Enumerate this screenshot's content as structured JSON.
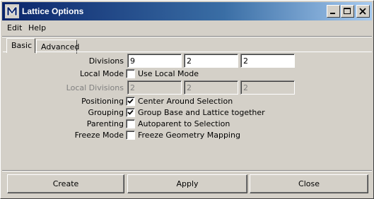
{
  "window": {
    "title": "Lattice Options",
    "icon": "maya-logo-icon",
    "controls": [
      "minimize-icon",
      "maximize-icon",
      "close-icon"
    ]
  },
  "menubar": {
    "items": [
      {
        "label": "Edit"
      },
      {
        "label": "Help"
      }
    ]
  },
  "tabs": [
    {
      "label": "Basic",
      "selected": true
    },
    {
      "label": "Advanced",
      "selected": false
    }
  ],
  "form": {
    "divisions": {
      "label": "Divisions",
      "values": [
        "9",
        "2",
        "2"
      ]
    },
    "local_mode": {
      "label": "Local Mode",
      "checkbox_label": "Use Local Mode",
      "checked": false
    },
    "local_divisions": {
      "label": "Local Divisions",
      "values": [
        "2",
        "2",
        "2"
      ],
      "enabled": false
    },
    "positioning": {
      "label": "Positioning",
      "checkbox_label": "Center Around Selection",
      "checked": true
    },
    "grouping": {
      "label": "Grouping",
      "checkbox_label": "Group Base and Lattice together",
      "checked": true
    },
    "parenting": {
      "label": "Parenting",
      "checkbox_label": "Autoparent to Selection",
      "checked": false
    },
    "freeze_mode": {
      "label": "Freeze Mode",
      "checkbox_label": "Freeze Geometry Mapping",
      "checked": false
    }
  },
  "buttons": {
    "create": "Create",
    "apply": "Apply",
    "close": "Close"
  }
}
